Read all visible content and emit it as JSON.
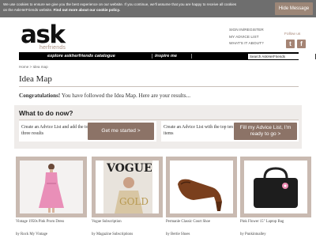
{
  "cookie_bar": {
    "text": "We use cookies to ensure we give you the best experience on our website. If you continue, we'll assume that you are happy to receive all cookies on the AskHerFriends website.",
    "link": "Find out more about our cookie policy.",
    "hide_button": "Hide Message"
  },
  "header": {
    "logo_main": "ask",
    "logo_sub": "herfriends",
    "user_links": [
      "SIGN IN/REGISTER",
      "MY ADVICE LIST",
      "WHAT'S IT ABOUT?"
    ],
    "follow_label": "Follow us",
    "social": [
      {
        "icon": "twitter-icon",
        "glyph": "t"
      },
      {
        "icon": "facebook-icon",
        "glyph": "f"
      }
    ]
  },
  "nav": {
    "items": [
      "explore askherfriends catalogue",
      "inspire me"
    ],
    "search_placeholder": "Search AskHerFriends"
  },
  "breadcrumb": "Home > Idea map",
  "page": {
    "title": "Idea Map",
    "congrats_bold": "Congratulations!",
    "congrats_rest": " You have followed the Idea Map. Here are your results..."
  },
  "what_to_do": {
    "title": "What to do now?",
    "cards": [
      {
        "text": "Create an Advice List and add the top three results",
        "button": "Get me started >"
      },
      {
        "text": "Create an Advice List with the top ten items",
        "button": "Fill my Advice List, I'm ready to go >"
      }
    ]
  },
  "products": [
    {
      "name": "Vintage 1950s Pink Prom Dress",
      "by": "by Rock My Vintage"
    },
    {
      "name": "Vogue Subscription",
      "by": "by Magazine Subscriptions"
    },
    {
      "name": "Permanle Classic Court Shoe",
      "by": "by Bertie Shoes"
    },
    {
      "name": "Pink Flower 15\" Laptop Bag",
      "by": "by Punkintoalley"
    }
  ],
  "colors": {
    "accent": "#8c7367",
    "frame": "#c9bab1",
    "nav_bg": "#000000",
    "cookie_bg": "#6e6e6e"
  }
}
